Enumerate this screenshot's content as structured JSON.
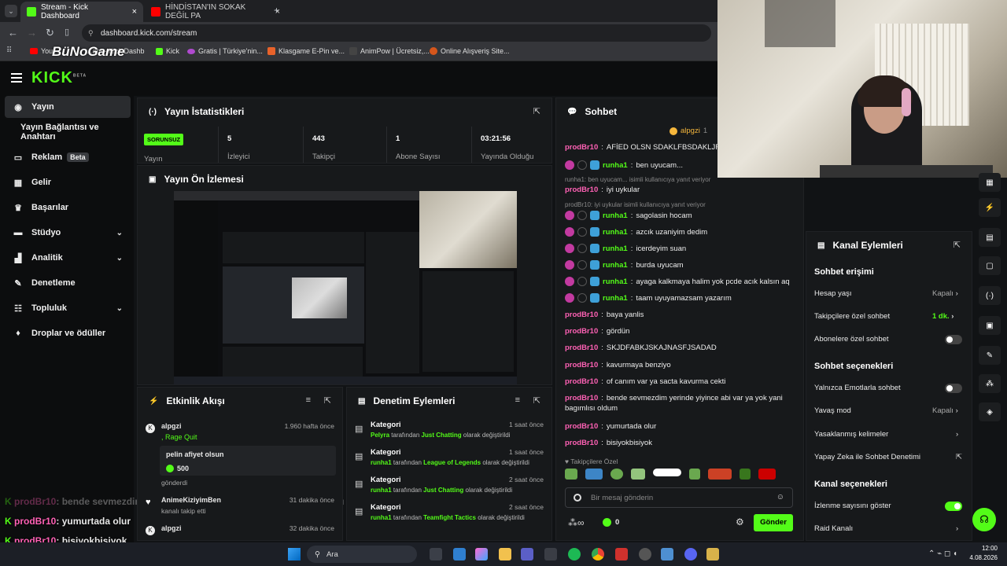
{
  "browser": {
    "tabs": [
      {
        "label": "Stream - Kick Dashboard",
        "active": true
      },
      {
        "label": "HİNDİSTAN'IN SOKAK DEĞİL PA",
        "active": false
      }
    ],
    "new_tab": "+",
    "url": "dashboard.kick.com/stream",
    "bookmarks": [
      "You...",
      "...am - Kick Dashb",
      "Kick",
      "Gratis | Türkiye'nin...",
      "Klasgame E-Pin ve...",
      "AnimPow | Ücretsiz,...",
      "Online Alışveriş Site..."
    ],
    "bookmark_overlay": "BüNoGame"
  },
  "header": {
    "logo": "KICK",
    "logo_sup": "BETA"
  },
  "sidebar": {
    "items": [
      {
        "label": "Yayın",
        "icon": "broadcast-icon"
      },
      {
        "label": "Yayın Bağlantısı ve Anahtarı",
        "icon": ""
      },
      {
        "label": "Reklam",
        "icon": "ad-icon",
        "badge": "Beta"
      },
      {
        "label": "Gelir",
        "icon": "revenue-icon"
      },
      {
        "label": "Başarılar",
        "icon": "trophy-icon"
      },
      {
        "label": "Stüdyo",
        "icon": "studio-icon"
      },
      {
        "label": "Analitik",
        "icon": "analytics-icon"
      },
      {
        "label": "Denetleme",
        "icon": "wrench-icon"
      },
      {
        "label": "Topluluk",
        "icon": "community-icon"
      },
      {
        "label": "Droplar ve ödüller",
        "icon": "drops-icon"
      }
    ]
  },
  "stats": {
    "title": "Yayın İstatistikleri",
    "status_badge": "SORUNSUZ",
    "status_label": "Yayın",
    "items": [
      {
        "value": "5",
        "label": "İzleyici"
      },
      {
        "value": "443",
        "label": "Takipçi"
      },
      {
        "value": "1",
        "label": "Abone Sayısı"
      },
      {
        "value": "03:21:56",
        "label": "Yayında Olduğu"
      }
    ]
  },
  "preview": {
    "title": "Yayın Ön İzlemesi"
  },
  "activity": {
    "title": "Etkinlik Akışı",
    "items": [
      {
        "user": "alpgzi",
        "sub": ", Rage Quit",
        "time": "1.960 hafta önce",
        "message": "pelin afiyet olsun",
        "amount": "500",
        "action": "gönderdi"
      },
      {
        "user": "AnimeKiziyimBen",
        "sub": "kanalı takip etti",
        "time": "31 dakika önce"
      },
      {
        "user": "alpgzi",
        "time": "32 dakika önce"
      }
    ]
  },
  "moderation": {
    "title": "Denetim Eylemleri",
    "items": [
      {
        "title": "Kategori",
        "time": "1 saat önce",
        "user": "Pelyra",
        "mid": "tarafından",
        "cat": "Just Chatting",
        "end": "olarak değiştirildi"
      },
      {
        "title": "Kategori",
        "time": "1 saat önce",
        "user": "runha1",
        "mid": "tarafından",
        "cat": "League of Legends",
        "end": "olarak değiştirildi"
      },
      {
        "title": "Kategori",
        "time": "2 saat önce",
        "user": "runha1",
        "mid": "tarafından",
        "cat": "Just Chatting",
        "end": "olarak değiştirildi"
      },
      {
        "title": "Kategori",
        "time": "2 saat önce",
        "user": "runha1",
        "mid": "tarafından",
        "cat": "Teamfight Tactics",
        "end": "olarak değiştirildi"
      }
    ]
  },
  "chat": {
    "title": "Sohbet",
    "pinned_user": "alpgzi",
    "pinned_count": "1",
    "messages": [
      {
        "user": "prodBr10",
        "color": "#ff61b5",
        "text": "AFİED OLSN SDAKLFBSDAKLJFN"
      },
      {
        "user": "runha1",
        "color": "#53fc18",
        "text": "ben uyucam...",
        "badges": true
      },
      {
        "reply": "runha1: ben uyucam... isimli kullanıcıya yanıt veriyor"
      },
      {
        "user": "prodBr10",
        "color": "#ff61b5",
        "text": "iyi uykular"
      },
      {
        "reply": "prodBr10: iyi uykular isimli kullanıcıya yanıt veriyor"
      },
      {
        "user": "runha1",
        "color": "#53fc18",
        "text": "sagolasin hocam",
        "badges": true
      },
      {
        "user": "runha1",
        "color": "#53fc18",
        "text": "azcık uzaniyim dedim",
        "badges": true
      },
      {
        "user": "runha1",
        "color": "#53fc18",
        "text": "icerdeyim suan",
        "badges": true
      },
      {
        "user": "runha1",
        "color": "#53fc18",
        "text": "burda uyucam",
        "badges": true
      },
      {
        "user": "runha1",
        "color": "#53fc18",
        "text": "ayaga kalkmaya halim yok pcde acık kalsın aq",
        "badges": true
      },
      {
        "user": "runha1",
        "color": "#53fc18",
        "text": "taam uyuyamazsam yazarım",
        "badges": true
      },
      {
        "user": "prodBr10",
        "color": "#ff61b5",
        "text": "baya yanlis"
      },
      {
        "user": "prodBr10",
        "color": "#ff61b5",
        "text": "gördün"
      },
      {
        "user": "prodBr10",
        "color": "#ff61b5",
        "text": "SKJDFABKJSKAJNASFJSADAD"
      },
      {
        "user": "prodBr10",
        "color": "#ff61b5",
        "text": "kavurmaya benziyo"
      },
      {
        "user": "prodBr10",
        "color": "#ff61b5",
        "text": "of canım var ya sacta kavurma cekti"
      },
      {
        "user": "prodBr10",
        "color": "#ff61b5",
        "text": "bende sevmezdim yerinde yiyince abi var ya yok yani",
        "text2": "bagımlısı oldum"
      },
      {
        "user": "prodBr10",
        "color": "#ff61b5",
        "text": "yumurtada olur"
      },
      {
        "user": "prodBr10",
        "color": "#ff61b5",
        "text": "bisiyokbisiyok"
      }
    ],
    "followers_only": "Takipçilere Özel",
    "input_placeholder": "Bir mesaj gönderin",
    "points": "0",
    "send_label": "Gönder"
  },
  "channel_actions": {
    "title": "Kanal Eylemleri",
    "sections": [
      {
        "heading": "Sohbet erişimi",
        "rows": [
          {
            "label": "Hesap yaşı",
            "value": "Kapalı",
            "type": "select"
          },
          {
            "label": "Takipçilere özel sohbet",
            "value": "1 dk.",
            "type": "select",
            "highlight": true
          },
          {
            "label": "Abonelere özel sohbet",
            "type": "toggle",
            "on": false
          }
        ]
      },
      {
        "heading": "Sohbet seçenekleri",
        "rows": [
          {
            "label": "Yalnızca Emotlarla sohbet",
            "type": "toggle",
            "on": false
          },
          {
            "label": "Yavaş mod",
            "value": "Kapalı",
            "type": "select"
          },
          {
            "label": "Yasaklanmış kelimeler",
            "type": "link"
          },
          {
            "label": "Yapay Zeka ile Sohbet Denetimi",
            "type": "external"
          }
        ]
      },
      {
        "heading": "Kanal seçenekleri",
        "rows": [
          {
            "label": "İzlenme sayısını göster",
            "type": "toggle",
            "on": true
          },
          {
            "label": "Raid Kanalı",
            "type": "link"
          }
        ]
      }
    ]
  },
  "overlay_chat": [
    {
      "user": "prodBr10",
      "text": ": bende sevmezdim yerinde yiyince abi var ya yok yani bağımlısı oldum",
      "faded": true
    },
    {
      "user": "prodBr10",
      "text": ": yumurtada olur"
    },
    {
      "user": "prodBr10",
      "text": ": bisiyokbisiyok"
    }
  ],
  "taskbar": {
    "search": "Ara",
    "time": "12:00",
    "date": "4.08.2026"
  },
  "colors": {
    "accent": "#53fc18",
    "pink": "#ff61b5",
    "bg": "#111315",
    "panel": "#17191b"
  }
}
